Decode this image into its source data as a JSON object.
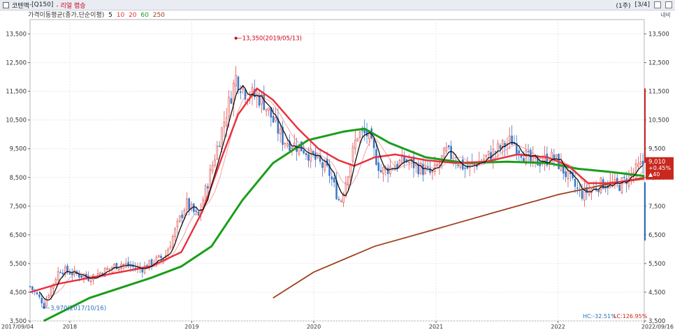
{
  "header": {
    "item_name": "코텐액",
    "item_code": "Q150",
    "market": "리얼 랩승",
    "period": "(1주)",
    "pages": "[3/4]",
    "tool_label": "내비"
  },
  "legend": {
    "prefix": "가격이동평균(종가,단순이평)",
    "periods": [
      "5",
      "10",
      "20",
      "60",
      "250"
    ],
    "colors": [
      "#111111",
      "#e8303a",
      "#e8303a",
      "#1a9e1a",
      "#a0401a"
    ]
  },
  "chart_data": {
    "type": "candlestick",
    "title": "",
    "xlabel": "",
    "ylabel": "",
    "ylim": [
      3500,
      14000
    ],
    "y_ticks": [
      3500,
      4500,
      5500,
      6500,
      7500,
      8500,
      9500,
      10500,
      11500,
      12500,
      13500
    ],
    "y_tick_labels": [
      "3,500",
      "4,500",
      "5,500",
      "6,500",
      "7,500",
      "8,500",
      "9,500",
      "10,500",
      "11,500",
      "12,500",
      "13,500"
    ],
    "x_range": [
      "2017-09-04",
      "2022-09-16"
    ],
    "x_ticks": [
      "2017-09-04",
      "2018-01-01",
      "2019-01-01",
      "2020-01-01",
      "2021-01-01",
      "2022-01-01",
      "2022-09-16"
    ],
    "x_tick_labels": [
      "2017/09/04",
      "2018",
      "2019",
      "2020",
      "2021",
      "2022",
      "2022/09/16"
    ],
    "grid": true,
    "moving_averages": [
      {
        "period": 5,
        "color": "#111111"
      },
      {
        "period": 10,
        "color": "#e8303a"
      },
      {
        "period": 20,
        "color": "#e8303a"
      },
      {
        "period": 60,
        "color": "#1a9e1a"
      },
      {
        "period": 250,
        "color": "#a0401a"
      }
    ],
    "price_path": [
      [
        "2017-09-04",
        4700
      ],
      [
        "2017-10-16",
        4100
      ],
      [
        "2017-12-01",
        5300
      ],
      [
        "2018-03-01",
        5000
      ],
      [
        "2018-06-01",
        5500
      ],
      [
        "2018-08-01",
        5300
      ],
      [
        "2018-10-15",
        5800
      ],
      [
        "2018-12-15",
        7600
      ],
      [
        "2019-01-20",
        7100
      ],
      [
        "2019-03-01",
        8800
      ],
      [
        "2019-05-13",
        12000
      ],
      [
        "2019-06-10",
        11500
      ],
      [
        "2019-08-01",
        11200
      ],
      [
        "2019-10-01",
        9800
      ],
      [
        "2019-12-01",
        9500
      ],
      [
        "2020-02-15",
        8700
      ],
      [
        "2020-03-20",
        7600
      ],
      [
        "2020-05-10",
        10000
      ],
      [
        "2020-06-10",
        10000
      ],
      [
        "2020-07-20",
        8700
      ],
      [
        "2020-10-01",
        9100
      ],
      [
        "2020-12-20",
        8600
      ],
      [
        "2021-02-01",
        9400
      ],
      [
        "2021-04-01",
        8800
      ],
      [
        "2021-06-01",
        9200
      ],
      [
        "2021-08-15",
        9800
      ],
      [
        "2021-10-15",
        9000
      ],
      [
        "2021-12-20",
        9200
      ],
      [
        "2022-03-10",
        7900
      ],
      [
        "2022-05-15",
        8300
      ],
      [
        "2022-07-01",
        8200
      ],
      [
        "2022-09-16",
        9010
      ]
    ],
    "ma20_path": [
      [
        "2017-09-04",
        4500
      ],
      [
        "2017-12-01",
        4800
      ],
      [
        "2018-03-01",
        5000
      ],
      [
        "2018-06-01",
        5200
      ],
      [
        "2018-09-01",
        5400
      ],
      [
        "2018-12-01",
        5900
      ],
      [
        "2019-02-01",
        7300
      ],
      [
        "2019-04-01",
        9200
      ],
      [
        "2019-05-20",
        10700
      ],
      [
        "2019-07-15",
        11600
      ],
      [
        "2019-09-01",
        11200
      ],
      [
        "2019-11-15",
        10200
      ],
      [
        "2020-01-15",
        9500
      ],
      [
        "2020-03-15",
        9100
      ],
      [
        "2020-05-01",
        8900
      ],
      [
        "2020-07-01",
        9200
      ],
      [
        "2020-09-01",
        9300
      ],
      [
        "2020-12-01",
        9100
      ],
      [
        "2021-03-01",
        9000
      ],
      [
        "2021-06-01",
        9050
      ],
      [
        "2021-09-01",
        9300
      ],
      [
        "2021-12-01",
        9200
      ],
      [
        "2022-02-01",
        8900
      ],
      [
        "2022-04-01",
        8300
      ],
      [
        "2022-06-01",
        8300
      ],
      [
        "2022-09-16",
        8450
      ]
    ],
    "ma60_path": [
      [
        "2017-10-15",
        3500
      ],
      [
        "2018-03-01",
        4300
      ],
      [
        "2018-09-01",
        5000
      ],
      [
        "2018-12-01",
        5400
      ],
      [
        "2019-03-01",
        6100
      ],
      [
        "2019-06-01",
        7700
      ],
      [
        "2019-09-01",
        9000
      ],
      [
        "2019-12-15",
        9800
      ],
      [
        "2020-04-01",
        10100
      ],
      [
        "2020-06-01",
        10200
      ],
      [
        "2020-08-15",
        9700
      ],
      [
        "2020-12-01",
        9200
      ],
      [
        "2021-04-01",
        9000
      ],
      [
        "2021-08-01",
        9050
      ],
      [
        "2021-12-01",
        9000
      ],
      [
        "2022-03-01",
        8800
      ],
      [
        "2022-06-01",
        8700
      ],
      [
        "2022-09-16",
        8550
      ]
    ],
    "ma250_path": [
      [
        "2019-09-01",
        4300
      ],
      [
        "2020-01-01",
        5200
      ],
      [
        "2020-07-01",
        6100
      ],
      [
        "2021-01-01",
        6700
      ],
      [
        "2021-07-01",
        7300
      ],
      [
        "2022-01-01",
        7900
      ],
      [
        "2022-05-01",
        8200
      ],
      [
        "2022-09-16",
        8500
      ]
    ],
    "annotations": [
      {
        "label": "13,350(2019/05/13)",
        "date": "2019-05-13",
        "value": 13350,
        "kind": "high",
        "color": "#d0021b"
      },
      {
        "label": "3,970(2017/10/16)",
        "date": "2017-10-16",
        "value": 3970,
        "kind": "low",
        "color": "#2a6ebb"
      }
    ],
    "last_price": {
      "price": "9,010",
      "change_pct": "+0.45%",
      "change": "▲40",
      "value": 9010
    },
    "footer_stats": {
      "hc": "HC:-32.51%",
      "lc": "LC:126.95%"
    }
  }
}
